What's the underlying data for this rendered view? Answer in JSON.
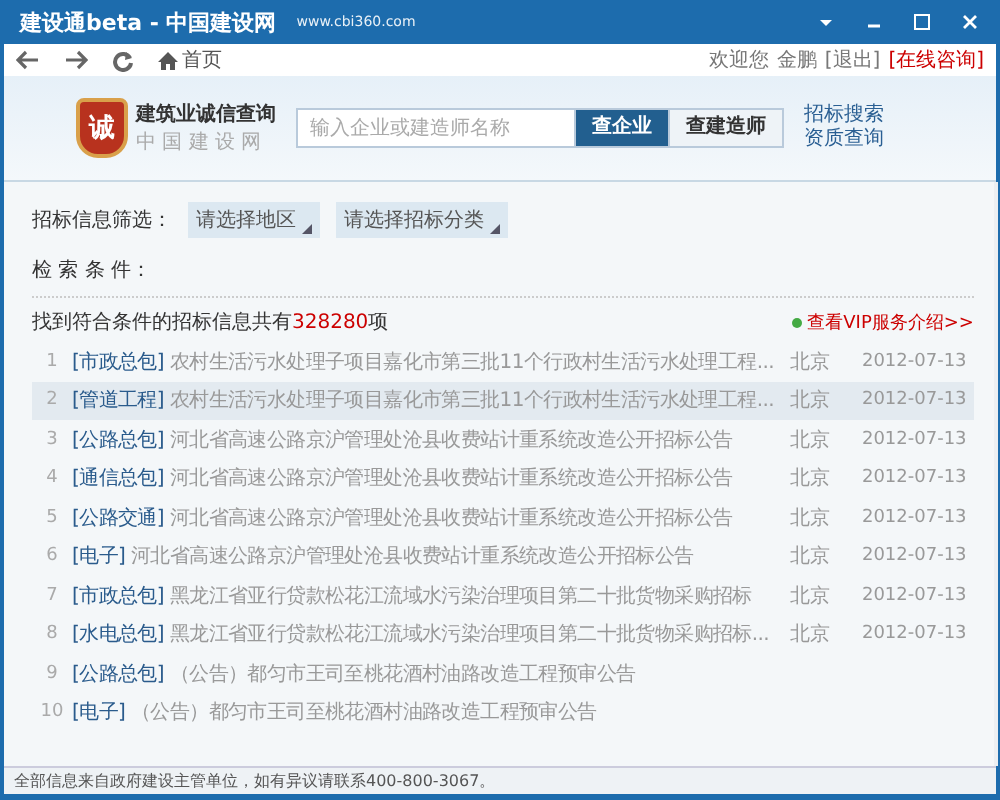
{
  "window": {
    "title": "建设通beta - 中国建设网",
    "url": "www.cbi360.com"
  },
  "toolbar": {
    "home": "首页",
    "welcome": "欢迎您",
    "user": "金鹏",
    "logout": "[退出]",
    "consult": "[在线咨询]"
  },
  "header": {
    "logo_mark": "诚",
    "logo_title": "建筑业诚信查询",
    "logo_sub": "中 国 建 设 网",
    "search": {
      "placeholder": "输入企业或建造师名称"
    },
    "search_buttons": [
      {
        "label": "查企业",
        "selected": true
      },
      {
        "label": "查建造师",
        "selected": false
      }
    ],
    "links": [
      "招标搜索",
      "资质查询"
    ]
  },
  "filter": {
    "label": "招标信息筛选：",
    "dropdowns": [
      "请选择地区",
      "请选择招标分类"
    ]
  },
  "criteria_label": "检 索 条 件：",
  "result": {
    "text": "找到符合条件的招标信息共有**328280**项",
    "vip": "查看VIP服务介绍>>"
  },
  "rows": [
    {
      "num": "1",
      "tag": "[市政总包]",
      "title": "农村生活污水处理子项目嘉化市第三批11个行政村生活污水处理工程...",
      "city": "北京",
      "date": "2012-07-13",
      "selected": false
    },
    {
      "num": "2",
      "tag": "[管道工程]",
      "title": "农村生活污水处理子项目嘉化市第三批11个行政村生活污水处理工程...",
      "city": "北京",
      "date": "2012-07-13",
      "selected": true
    },
    {
      "num": "3",
      "tag": "[公路总包]",
      "title": "河北省高速公路京沪管理处沧县收费站计重系统改造公开招标公告",
      "city": "北京",
      "date": "2012-07-13",
      "selected": false
    },
    {
      "num": "4",
      "tag": "[通信总包]",
      "title": "河北省高速公路京沪管理处沧县收费站计重系统改造公开招标公告",
      "city": "北京",
      "date": "2012-07-13",
      "selected": false
    },
    {
      "num": "5",
      "tag": "[公路交通]",
      "title": "河北省高速公路京沪管理处沧县收费站计重系统改造公开招标公告",
      "city": "北京",
      "date": "2012-07-13",
      "selected": false
    },
    {
      "num": "6",
      "tag": "[电子]",
      "title": "河北省高速公路京沪管理处沧县收费站计重系统改造公开招标公告",
      "city": "北京",
      "date": "2012-07-13",
      "selected": false
    },
    {
      "num": "7",
      "tag": "[市政总包]",
      "title": "黑龙江省亚行贷款松花江流域水污染治理项目第二十批货物采购招标",
      "city": "北京",
      "date": "2012-07-13",
      "selected": false
    },
    {
      "num": "8",
      "tag": "[水电总包]",
      "title": "黑龙江省亚行贷款松花江流域水污染治理项目第二十批货物采购招标...",
      "city": "北京",
      "date": "2012-07-13",
      "selected": false
    },
    {
      "num": "9",
      "tag": "[公路总包]",
      "title": "（公告）都匀市王司至桃花酒村油路改造工程预审公告",
      "selected": false
    },
    {
      "num": "10",
      "tag": "[电子]",
      "title": "（公告）都匀市王司至桃花酒村油路改造工程预审公告",
      "selected": false
    }
  ],
  "status_bar": "全部信息来自政府建设主管单位，如有异议请联系400-800-3067。"
}
